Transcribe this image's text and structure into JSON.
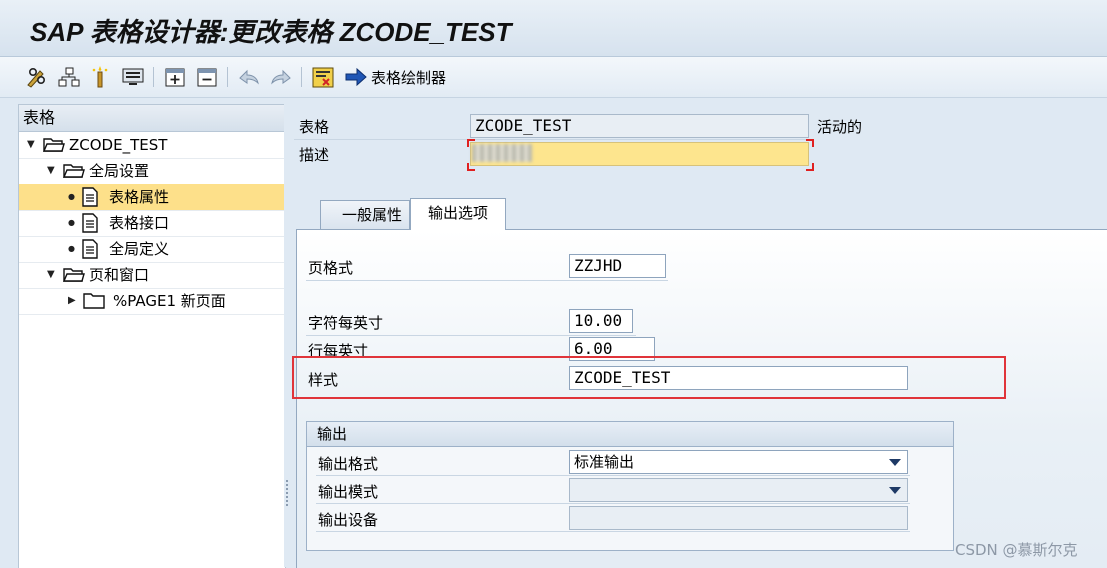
{
  "window": {
    "title": "SAP 表格设计器:更改表格 ZCODE_TEST"
  },
  "toolbar": {
    "buttons": [
      {
        "icon": "pencil-glasses-icon"
      },
      {
        "icon": "hierarchy-icon"
      },
      {
        "icon": "magic-wand-icon"
      },
      {
        "icon": "display-icon"
      },
      {
        "icon": "create-object-icon"
      },
      {
        "icon": "delete-object-icon"
      },
      {
        "icon": "undo-icon"
      },
      {
        "icon": "redo-icon"
      },
      {
        "icon": "test-icon"
      }
    ],
    "form_painter_label": "表格绘制器"
  },
  "tree": {
    "header": "表格",
    "nodes": [
      {
        "label": "ZCODE_TEST",
        "level": 0,
        "expanded": true,
        "icon": "open-folder-icon"
      },
      {
        "label": "全局设置",
        "level": 1,
        "expanded": true,
        "icon": "open-folder-icon"
      },
      {
        "label": "表格属性",
        "level": 2,
        "icon": "document-icon",
        "selected": true
      },
      {
        "label": "表格接口",
        "level": 2,
        "icon": "document-icon"
      },
      {
        "label": "全局定义",
        "level": 2,
        "icon": "document-icon"
      },
      {
        "label": "页和窗口",
        "level": 1,
        "expanded": true,
        "icon": "open-folder-icon"
      },
      {
        "label": "%PAGE1 新页面",
        "level": 2,
        "expanded": false,
        "icon": "folder-icon"
      }
    ]
  },
  "header_fields": {
    "form_label": "表格",
    "form_value": "ZCODE_TEST",
    "status": "活动的",
    "desc_label": "描述",
    "desc_value": ""
  },
  "tabs": [
    {
      "label": "一般属性",
      "active": false
    },
    {
      "label": "输出选项",
      "active": true
    }
  ],
  "output_options": {
    "page_format_label": "页格式",
    "page_format_value": "ZZJHD",
    "cpi_label": "字符每英寸",
    "cpi_value": "10.00",
    "lpi_label": "行每英寸",
    "lpi_value": "6.00",
    "style_label": "样式",
    "style_value": "ZCODE_TEST"
  },
  "output_group": {
    "title": "输出",
    "format_label": "输出格式",
    "format_value": "标准输出",
    "mode_label": "输出模式",
    "mode_value": "",
    "device_label": "输出设备",
    "device_value": ""
  },
  "watermark": "CSDN @慕斯尔克",
  "colors": {
    "selected_row": "#fde08a",
    "required_field": "#fde58e",
    "highlight_box": "#e0343a"
  }
}
